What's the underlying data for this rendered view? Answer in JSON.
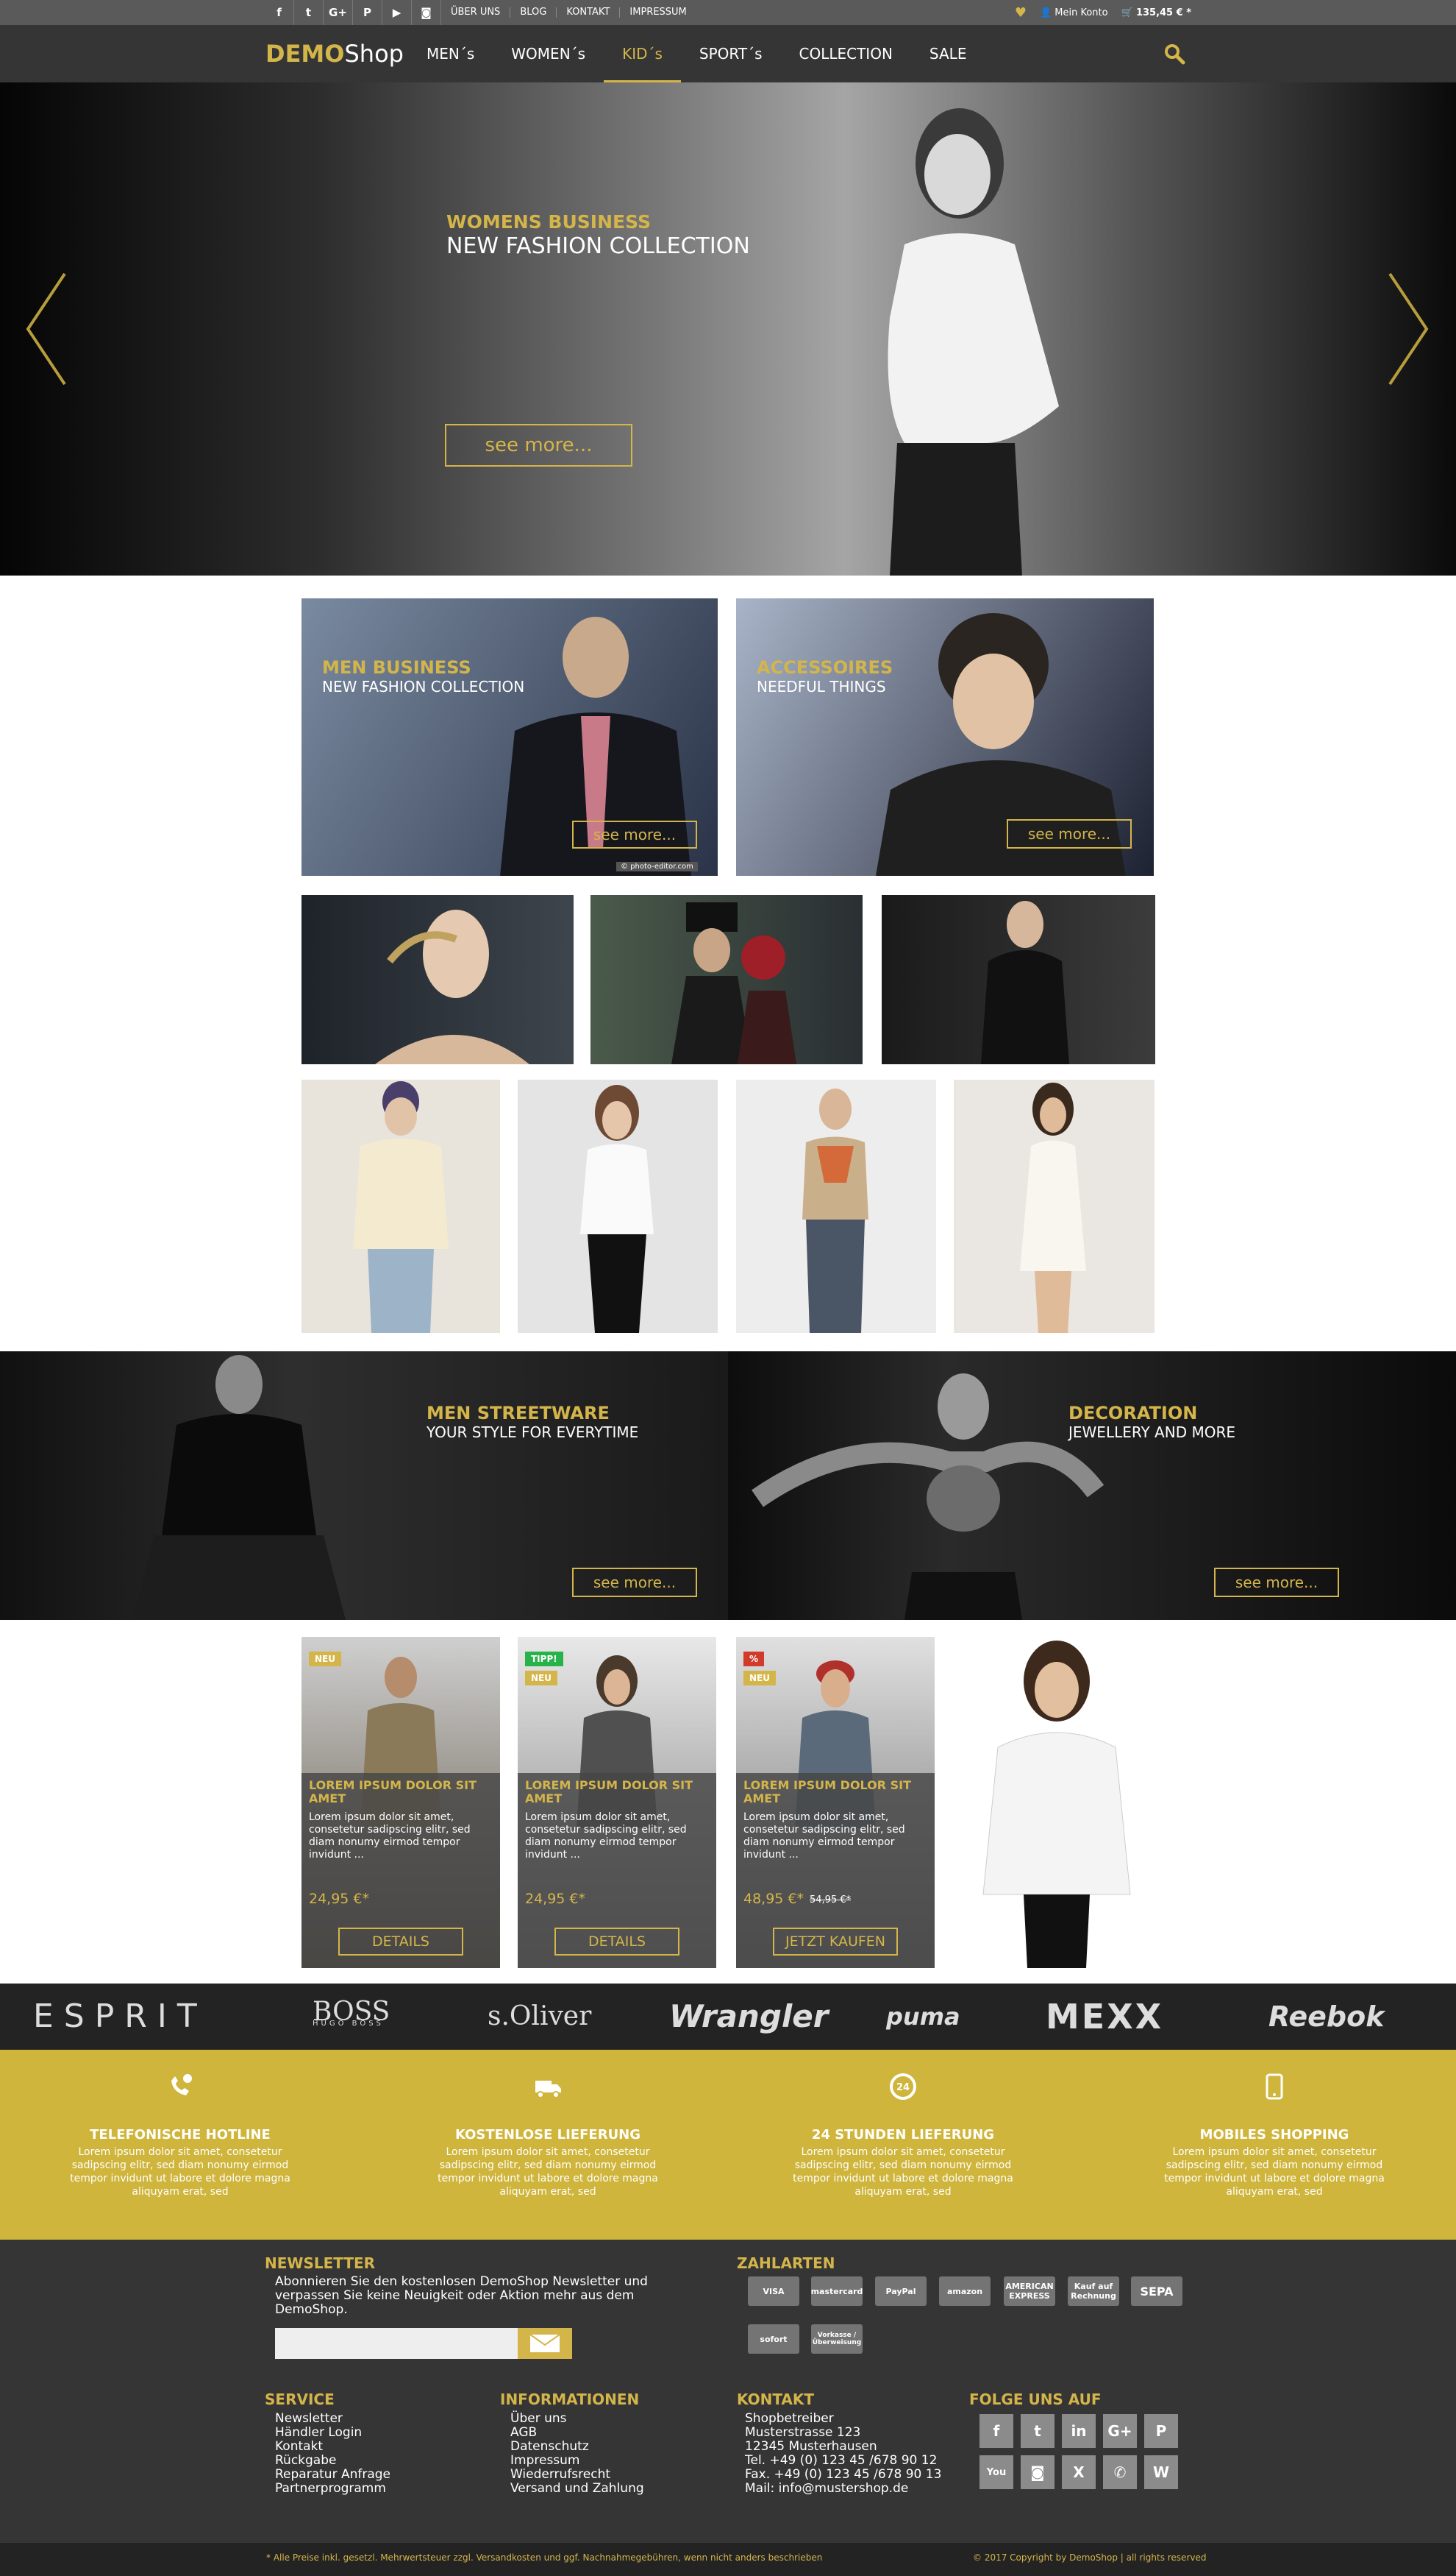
{
  "topbar": {
    "social": [
      "f",
      "t",
      "G+",
      "P",
      "▶",
      "◙"
    ],
    "links": [
      "ÜBER UNS",
      "BLOG",
      "KONTAKT",
      "IMPRESSUM"
    ],
    "account": "Mein Konto",
    "cart_total": "135,45 € *"
  },
  "nav": {
    "logo_bold": "DEMO",
    "logo_rest": "Shop",
    "items": [
      "MEN´s",
      "WOMEN´s",
      "KID´s",
      "SPORT´s",
      "COLLECTION",
      "SALE"
    ],
    "active": "KID´s"
  },
  "hero": {
    "title": "WOMENS BUSINESS",
    "subtitle": "NEW FASHION COLLECTION",
    "button": "see more..."
  },
  "tiles": {
    "men_business": {
      "title": "MEN BUSINESS",
      "subtitle": "NEW FASHION COLLECTION",
      "button": "see more...",
      "credit": "© photo-editor.com"
    },
    "accessoires": {
      "title": "ACCESSOIRES",
      "subtitle": "NEEDFUL THINGS",
      "button": "see more..."
    },
    "men_streetware": {
      "title": "MEN STREETWARE",
      "subtitle": "YOUR STYLE FOR EVERYTIME",
      "button": "see more..."
    },
    "decoration": {
      "title": "DECORATION",
      "subtitle": "JEWELLERY AND MORE",
      "button": "see more..."
    }
  },
  "products": [
    {
      "badges": [
        "NEU"
      ],
      "title": "LOREM IPSUM DOLOR SIT AMET",
      "desc": "Lorem ipsum dolor sit amet, consetetur sadipscing elitr, sed diam nonumy eirmod tempor invidunt ...",
      "price": "24,95 €*",
      "old_price": "",
      "button": "DETAILS"
    },
    {
      "badges": [
        "TIPP!",
        "NEU"
      ],
      "title": "LOREM IPSUM DOLOR SIT AMET",
      "desc": "Lorem ipsum dolor sit amet, consetetur sadipscing elitr, sed diam nonumy eirmod tempor invidunt ...",
      "price": "24,95 €*",
      "old_price": "",
      "button": "DETAILS"
    },
    {
      "badges": [
        "%",
        "NEU"
      ],
      "title": "LOREM IPSUM DOLOR SIT AMET",
      "desc": "Lorem ipsum dolor sit amet, consetetur sadipscing elitr, sed diam nonumy eirmod tempor invidunt ...",
      "price": "48,95 €*",
      "old_price": "54,95 €*",
      "button": "JETZT KAUFEN"
    }
  ],
  "brands": [
    "ESPRIT",
    "BOSS",
    "s.Oliver",
    "Wrangler",
    "puma",
    "MEXX",
    "Reebok"
  ],
  "boss_sub": "HUGO BOSS",
  "features": [
    {
      "title": "TELEFONISCHE HOTLINE",
      "desc": "Lorem ipsum dolor sit amet, consetetur sadipscing elitr, sed diam nonumy eirmod tempor invidunt ut labore et dolore magna aliquyam erat, sed"
    },
    {
      "title": "KOSTENLOSE LIEFERUNG",
      "desc": "Lorem ipsum dolor sit amet, consetetur sadipscing elitr, sed diam nonumy eirmod tempor invidunt ut labore et dolore magna aliquyam erat, sed"
    },
    {
      "title": "24 STUNDEN LIEFERUNG",
      "desc": "Lorem ipsum dolor sit amet, consetetur sadipscing elitr, sed diam nonumy eirmod tempor invidunt ut labore et dolore magna aliquyam erat, sed"
    },
    {
      "title": "MOBILES SHOPPING",
      "desc": "Lorem ipsum dolor sit amet, consetetur sadipscing elitr, sed diam nonumy eirmod tempor invidunt ut labore et dolore magna aliquyam erat, sed"
    }
  ],
  "footer": {
    "newsletter_title": "NEWSLETTER",
    "newsletter_text": "Abonnieren Sie den kostenlosen DemoShop Newsletter und verpassen Sie keine Neuigkeit oder Aktion mehr aus dem DemoShop.",
    "newsletter_placeholder": "",
    "payment_title": "ZAHLARTEN",
    "payments": [
      "VISA",
      "mastercard",
      "PayPal",
      "amazon",
      "AMERICAN EXPRESS",
      "Kauf auf Rechnung",
      "SEPA",
      "sofort",
      "Vorkasse / Überweisung"
    ],
    "service_title": "SERVICE",
    "service": [
      "Newsletter",
      "Händler Login",
      "Kontakt",
      "Rückgabe",
      "Reparatur Anfrage",
      "Partnerprogramm"
    ],
    "info_title": "INFORMATIONEN",
    "info": [
      "Über uns",
      "AGB",
      "Datenschutz",
      "Impressum",
      "Wiederrufsrecht",
      "Versand und Zahlung"
    ],
    "contact_title": "KONTAKT",
    "contact": [
      "Shopbetreiber",
      "Musterstrasse 123",
      "12345 Musterhausen",
      "Tel. +49 (0) 123 45 /678 90 12",
      "Fax. +49 (0) 123 45 /678 90 13",
      "Mail: info@mustershop.de"
    ],
    "follow_title": "FOLGE UNS AUF",
    "follow": [
      "f",
      "t",
      "in",
      "G+",
      "P",
      "You",
      "◙",
      "X",
      "✆",
      "W"
    ]
  },
  "bottom": {
    "left": "* Alle Preise inkl. gesetzl. Mehrwertsteuer zzgl. Versandkosten und ggf. Nachnahmegebühren, wenn nicht anders beschrieben",
    "right": "© 2017  Copyright by DemoShop  |  all rights reserved"
  },
  "colors": {
    "accent": "#d4b54a",
    "dark": "#353535",
    "features_bg": "#cfb53c"
  }
}
